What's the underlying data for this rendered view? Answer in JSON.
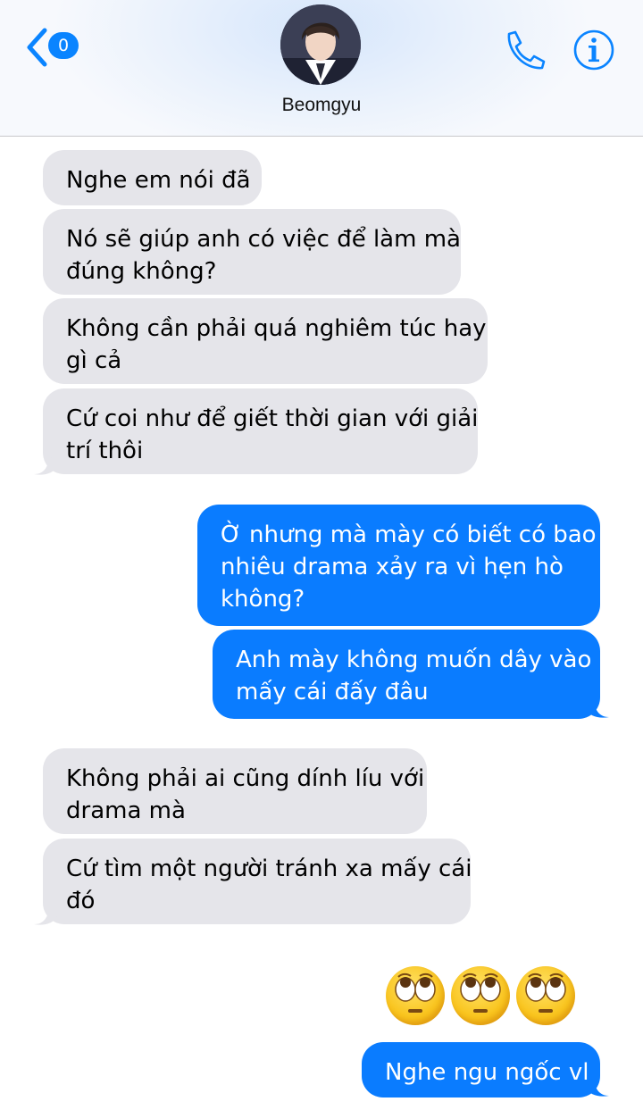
{
  "header": {
    "back_count": "0",
    "contact_name": "Beomgyu",
    "avatar_icon": "profile-photo",
    "phone_icon": "phone-icon",
    "info_icon": "info-icon"
  },
  "colors": {
    "accent": "#0a7cff",
    "incoming_bubble": "#e5e5ea",
    "outgoing_bubble": "#0a7cff"
  },
  "messages": [
    {
      "direction": "incoming",
      "lines": [
        "Nghe em nói đã"
      ]
    },
    {
      "direction": "incoming",
      "lines": [
        "Nó sẽ giúp anh có việc để làm mà",
        "đúng không?"
      ]
    },
    {
      "direction": "incoming",
      "lines": [
        "Không cần phải quá nghiêm túc hay",
        "gì cả"
      ]
    },
    {
      "direction": "incoming",
      "lines": [
        "Cứ coi như để giết thời gian với giải",
        "trí thôi"
      ]
    },
    {
      "direction": "outgoing",
      "lines": [
        "Ờ nhưng mà mày có biết có bao",
        "nhiêu drama xảy ra vì hẹn hò",
        "không?"
      ]
    },
    {
      "direction": "outgoing",
      "lines": [
        "Anh mày không muốn dây vào",
        "mấy cái đấy đâu"
      ]
    },
    {
      "direction": "incoming",
      "lines": [
        "Không phải ai cũng dính líu với",
        "drama mà"
      ]
    },
    {
      "direction": "incoming",
      "lines": [
        "Cứ tìm một người tránh xa mấy cái",
        "đó"
      ]
    },
    {
      "direction": "outgoing",
      "emoji": [
        "face-with-rolling-eyes",
        "face-with-rolling-eyes",
        "face-with-rolling-eyes"
      ]
    },
    {
      "direction": "outgoing",
      "lines": [
        "Nghe ngu ngốc vl"
      ]
    }
  ]
}
